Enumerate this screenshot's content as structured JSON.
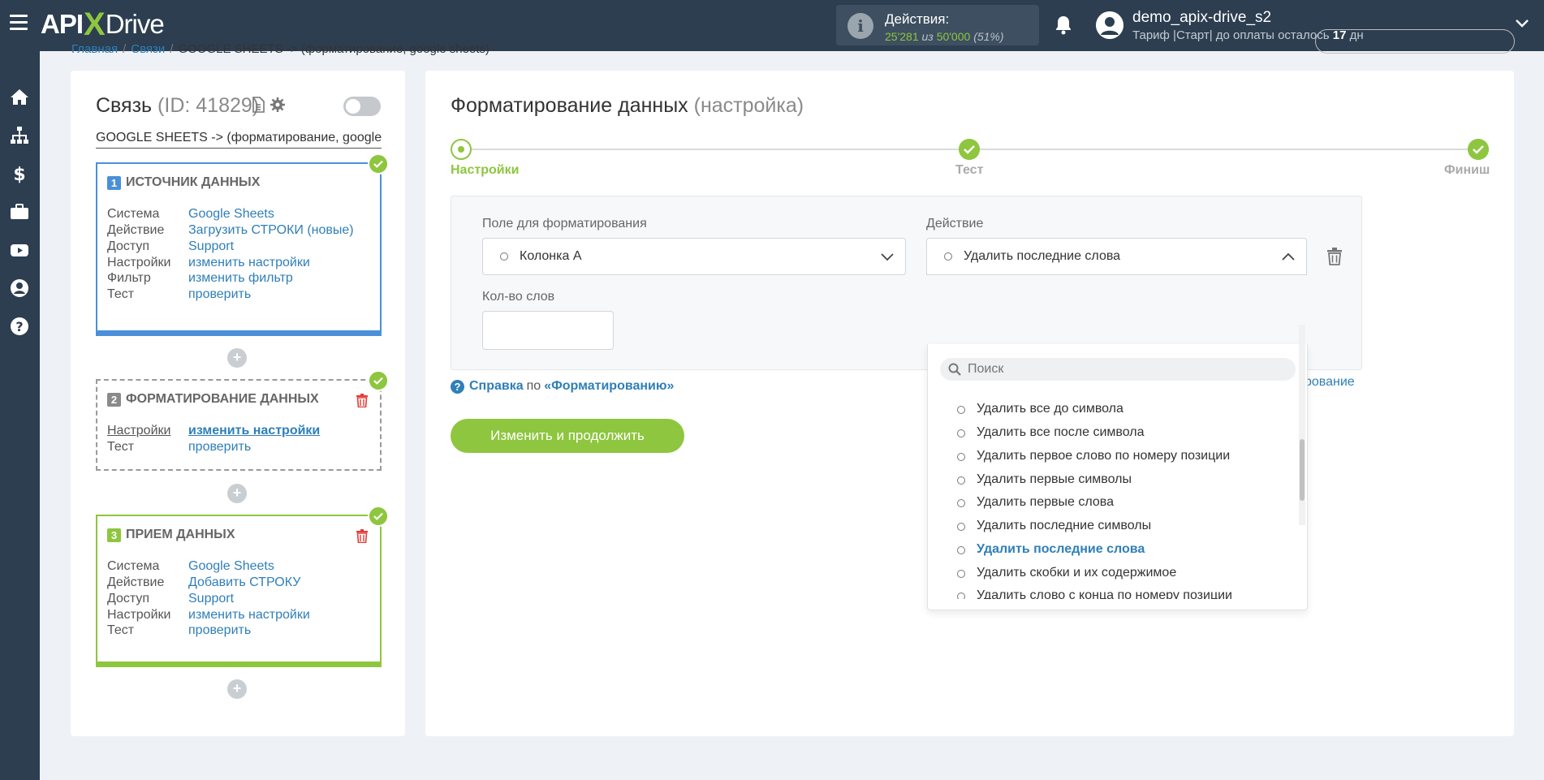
{
  "header": {
    "logo_api": "API",
    "logo_x": "X",
    "logo_drive": "Drive",
    "actions_label": "Действия:",
    "actions_used": "25'281",
    "actions_of": "из",
    "actions_total": "50'000",
    "actions_pct": "(51%)",
    "user_name": "demo_apix-drive_s2",
    "plan_text": "Тариф |Старт| до оплаты осталось",
    "plan_days": "17",
    "plan_days_unit": "дн"
  },
  "breadcrumb": {
    "home": "Главная",
    "links": "Связи",
    "current1": "GOOGLE SHEETS",
    "arrow": "->",
    "current2": "(форматирование, google sheets)"
  },
  "sidebar": {
    "icons": [
      "home-icon",
      "sitemap-icon",
      "dollar-icon",
      "briefcase-icon",
      "youtube-icon",
      "user-icon",
      "help-icon"
    ]
  },
  "connection": {
    "title": "Связь",
    "id_text": "(ID: 41829)",
    "name": "GOOGLE SHEETS -> (форматирование, google sheets)",
    "blocks": [
      {
        "num": "1",
        "title": "ИСТОЧНИК ДАННЫХ",
        "rows": [
          {
            "k": "Система",
            "v": "Google Sheets"
          },
          {
            "k": "Действие",
            "v": "Загрузить СТРОКИ (новые)"
          },
          {
            "k": "Доступ",
            "v": "Support"
          },
          {
            "k": "Настройки",
            "v": "изменить настройки"
          },
          {
            "k": "Фильтр",
            "v": "изменить фильтр"
          },
          {
            "k": "Тест",
            "v": "проверить"
          }
        ]
      },
      {
        "num": "2",
        "title": "ФОРМАТИРОВАНИЕ ДАННЫХ",
        "rows": [
          {
            "k": "Настройки",
            "v": "изменить настройки"
          },
          {
            "k": "Тест",
            "v": "проверить"
          }
        ]
      },
      {
        "num": "3",
        "title": "ПРИЕМ ДАННЫХ",
        "rows": [
          {
            "k": "Система",
            "v": "Google Sheets"
          },
          {
            "k": "Действие",
            "v": "Добавить СТРОКУ"
          },
          {
            "k": "Доступ",
            "v": "Support"
          },
          {
            "k": "Настройки",
            "v": "изменить настройки"
          },
          {
            "k": "Тест",
            "v": "проверить"
          }
        ]
      }
    ],
    "plus": "+"
  },
  "main": {
    "title": "Форматирование данных",
    "subtitle": "(настройка)",
    "steps": [
      "Настройки",
      "Тест",
      "Финиш"
    ],
    "field_label": "Поле для форматирования",
    "field_value": "Колонка A",
    "action_label": "Действие",
    "action_value": "Удалить последние слова",
    "word_count_label": "Кол-во слов",
    "word_count_value": "",
    "help_prefix": "Справка",
    "help_mid": "по",
    "help_link": "«Форматированию»",
    "right_link": "рование",
    "submit": "Изменить и продолжить"
  },
  "dropdown": {
    "search_placeholder": "Поиск",
    "options": [
      "Удалить все до символа",
      "Удалить все после символа",
      "Удалить первое слово по номеру позиции",
      "Удалить первые символы",
      "Удалить первые слова",
      "Удалить последние символы",
      "Удалить последние слова",
      "Удалить скобки и их содержимое",
      "Удалить слово с конца по номеру позиции"
    ],
    "selected_index": 6
  },
  "colors": {
    "accent_green": "#8ec63f",
    "link_blue": "#2f7fb8",
    "dark_bg": "#2c3e50",
    "danger_red": "#e53935"
  }
}
